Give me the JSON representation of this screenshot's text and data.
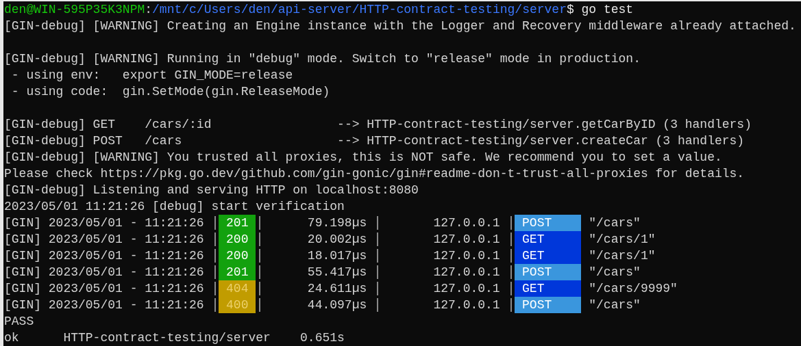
{
  "terminal": {
    "lines": [
      {
        "kind": "prompt",
        "user": "den@WIN-595P35K3NPM",
        "separator": ":",
        "path": "/mnt/c/Users/den/api-server/HTTP-contract-testing/server",
        "command": "$ go test"
      },
      {
        "kind": "text",
        "text": "[GIN-debug] [WARNING] Creating an Engine instance with the Logger and Recovery middleware already attached."
      },
      {
        "kind": "blank"
      },
      {
        "kind": "text",
        "text": "[GIN-debug] [WARNING] Running in \"debug\" mode. Switch to \"release\" mode in production."
      },
      {
        "kind": "text",
        "text": " - using env:   export GIN_MODE=release"
      },
      {
        "kind": "text",
        "text": " - using code:  gin.SetMode(gin.ReleaseMode)"
      },
      {
        "kind": "blank"
      },
      {
        "kind": "text",
        "text": "[GIN-debug] GET    /cars/:id                 --> HTTP-contract-testing/server.getCarByID (3 handlers)"
      },
      {
        "kind": "text",
        "text": "[GIN-debug] POST   /cars                     --> HTTP-contract-testing/server.createCar (3 handlers)"
      },
      {
        "kind": "text",
        "text": "[GIN-debug] [WARNING] You trusted all proxies, this is NOT safe. We recommend you to set a value."
      },
      {
        "kind": "text",
        "text": "Please check https://pkg.go.dev/github.com/gin-gonic/gin#readme-don-t-trust-all-proxies for details."
      },
      {
        "kind": "text",
        "text": "[GIN-debug] Listening and serving HTTP on localhost:8080"
      },
      {
        "kind": "text",
        "text": "2023/05/01 11:21:26 [debug] start verification"
      },
      {
        "kind": "request",
        "prefix": "[GIN] 2023/05/01 - 11:21:26",
        "status": {
          "text": "201",
          "color": "#13a10e"
        },
        "latency": "79.198µs",
        "ip": "127.0.0.1",
        "method": {
          "text": "POST",
          "color": "#3a96dd"
        },
        "path": "\"/cars\""
      },
      {
        "kind": "request",
        "prefix": "[GIN] 2023/05/01 - 11:21:26",
        "status": {
          "text": "200",
          "color": "#13a10e"
        },
        "latency": "20.002µs",
        "ip": "127.0.0.1",
        "method": {
          "text": "GET",
          "color": "#0037da"
        },
        "path": "\"/cars/1\""
      },
      {
        "kind": "request",
        "prefix": "[GIN] 2023/05/01 - 11:21:26",
        "status": {
          "text": "200",
          "color": "#13a10e"
        },
        "latency": "18.017µs",
        "ip": "127.0.0.1",
        "method": {
          "text": "GET",
          "color": "#0037da"
        },
        "path": "\"/cars/1\""
      },
      {
        "kind": "request",
        "prefix": "[GIN] 2023/05/01 - 11:21:26",
        "status": {
          "text": "201",
          "color": "#13a10e"
        },
        "latency": "55.417µs",
        "ip": "127.0.0.1",
        "method": {
          "text": "POST",
          "color": "#3a96dd"
        },
        "path": "\"/cars\""
      },
      {
        "kind": "request",
        "prefix": "[GIN] 2023/05/01 - 11:21:26",
        "status": {
          "text": "404",
          "color": "#c19c00"
        },
        "latency": "24.611µs",
        "ip": "127.0.0.1",
        "method": {
          "text": "GET",
          "color": "#0037da"
        },
        "path": "\"/cars/9999\""
      },
      {
        "kind": "request",
        "prefix": "[GIN] 2023/05/01 - 11:21:26",
        "status": {
          "text": "400",
          "color": "#c19c00"
        },
        "latency": "44.097µs",
        "ip": "127.0.0.1",
        "method": {
          "text": "POST",
          "color": "#3a96dd"
        },
        "path": "\"/cars\""
      },
      {
        "kind": "text",
        "text": "PASS"
      },
      {
        "kind": "text",
        "text": "ok      HTTP-contract-testing/server    0.651s"
      }
    ]
  }
}
